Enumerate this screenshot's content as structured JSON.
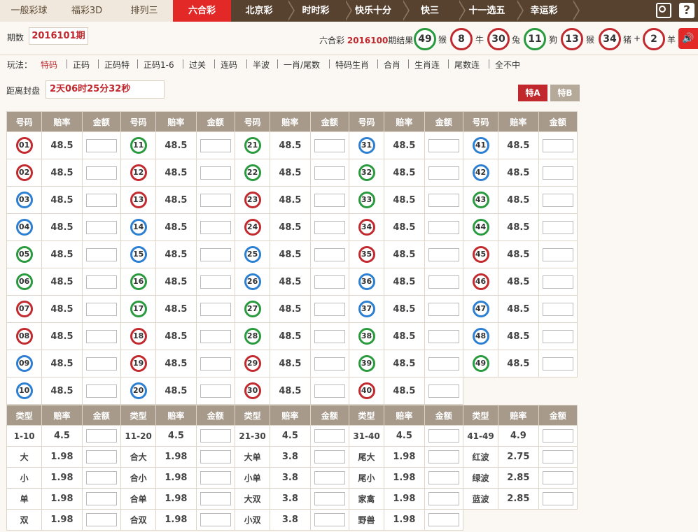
{
  "nav": {
    "tabs": [
      "一般彩球",
      "福彩3D",
      "排列三",
      "六合彩",
      "北京彩",
      "时时彩",
      "快乐十分",
      "快三",
      "十一选五",
      "幸运彩"
    ],
    "active": "六合彩"
  },
  "period": {
    "label": "期数",
    "value": "2016101期",
    "result_prefix": "六合彩",
    "result_period": "2016100",
    "result_suffix": "期结果",
    "plus": "+",
    "result_balls": [
      {
        "num": "49",
        "zodiac": "猴",
        "color": "green"
      },
      {
        "num": "8",
        "zodiac": "牛",
        "color": "red"
      },
      {
        "num": "30",
        "zodiac": "兔",
        "color": "red"
      },
      {
        "num": "11",
        "zodiac": "狗",
        "color": "green"
      },
      {
        "num": "13",
        "zodiac": "猴",
        "color": "red"
      },
      {
        "num": "34",
        "zodiac": "猪",
        "color": "red"
      },
      {
        "num": "2",
        "zodiac": "羊",
        "color": "red"
      }
    ]
  },
  "play": {
    "label": "玩法：",
    "items": [
      "特码",
      "正码",
      "正码特",
      "正码1-6",
      "过关",
      "连码",
      "半波",
      "一肖/尾数",
      "特码生肖",
      "合肖",
      "生肖连",
      "尾数连",
      "全不中"
    ],
    "selected": "特码"
  },
  "countdown": {
    "label": "距离封盘",
    "value": "2天06时25分32秒"
  },
  "buttons": {
    "a": "特A",
    "b": "特B"
  },
  "num_table": {
    "headers": [
      "号码",
      "赔率",
      "金额"
    ],
    "odds": "48.5",
    "balls": [
      {
        "n": "01",
        "c": "red"
      },
      {
        "n": "02",
        "c": "red"
      },
      {
        "n": "03",
        "c": "blue"
      },
      {
        "n": "04",
        "c": "blue"
      },
      {
        "n": "05",
        "c": "green"
      },
      {
        "n": "06",
        "c": "green"
      },
      {
        "n": "07",
        "c": "red"
      },
      {
        "n": "08",
        "c": "red"
      },
      {
        "n": "09",
        "c": "blue"
      },
      {
        "n": "10",
        "c": "blue"
      },
      {
        "n": "11",
        "c": "green"
      },
      {
        "n": "12",
        "c": "red"
      },
      {
        "n": "13",
        "c": "red"
      },
      {
        "n": "14",
        "c": "blue"
      },
      {
        "n": "15",
        "c": "blue"
      },
      {
        "n": "16",
        "c": "green"
      },
      {
        "n": "17",
        "c": "green"
      },
      {
        "n": "18",
        "c": "red"
      },
      {
        "n": "19",
        "c": "red"
      },
      {
        "n": "20",
        "c": "blue"
      },
      {
        "n": "21",
        "c": "green"
      },
      {
        "n": "22",
        "c": "green"
      },
      {
        "n": "23",
        "c": "red"
      },
      {
        "n": "24",
        "c": "red"
      },
      {
        "n": "25",
        "c": "blue"
      },
      {
        "n": "26",
        "c": "blue"
      },
      {
        "n": "27",
        "c": "green"
      },
      {
        "n": "28",
        "c": "green"
      },
      {
        "n": "29",
        "c": "red"
      },
      {
        "n": "30",
        "c": "red"
      },
      {
        "n": "31",
        "c": "blue"
      },
      {
        "n": "32",
        "c": "green"
      },
      {
        "n": "33",
        "c": "green"
      },
      {
        "n": "34",
        "c": "red"
      },
      {
        "n": "35",
        "c": "red"
      },
      {
        "n": "36",
        "c": "blue"
      },
      {
        "n": "37",
        "c": "blue"
      },
      {
        "n": "38",
        "c": "green"
      },
      {
        "n": "39",
        "c": "green"
      },
      {
        "n": "40",
        "c": "red"
      },
      {
        "n": "41",
        "c": "blue"
      },
      {
        "n": "42",
        "c": "blue"
      },
      {
        "n": "43",
        "c": "green"
      },
      {
        "n": "44",
        "c": "green"
      },
      {
        "n": "45",
        "c": "red"
      },
      {
        "n": "46",
        "c": "red"
      },
      {
        "n": "47",
        "c": "blue"
      },
      {
        "n": "48",
        "c": "blue"
      },
      {
        "n": "49",
        "c": "green"
      }
    ]
  },
  "type_table": {
    "headers": [
      "类型",
      "赔率",
      "金额"
    ],
    "columns": [
      [
        {
          "t": "1-10",
          "o": "4.5"
        },
        {
          "t": "大",
          "o": "1.98"
        },
        {
          "t": "小",
          "o": "1.98"
        },
        {
          "t": "单",
          "o": "1.98"
        },
        {
          "t": "双",
          "o": "1.98"
        }
      ],
      [
        {
          "t": "11-20",
          "o": "4.5"
        },
        {
          "t": "合大",
          "o": "1.98"
        },
        {
          "t": "合小",
          "o": "1.98"
        },
        {
          "t": "合单",
          "o": "1.98"
        },
        {
          "t": "合双",
          "o": "1.98"
        }
      ],
      [
        {
          "t": "21-30",
          "o": "4.5"
        },
        {
          "t": "大单",
          "o": "3.8"
        },
        {
          "t": "小单",
          "o": "3.8"
        },
        {
          "t": "大双",
          "o": "3.8"
        },
        {
          "t": "小双",
          "o": "3.8"
        }
      ],
      [
        {
          "t": "31-40",
          "o": "4.5"
        },
        {
          "t": "尾大",
          "o": "1.98"
        },
        {
          "t": "尾小",
          "o": "1.98"
        },
        {
          "t": "家禽",
          "o": "1.98"
        },
        {
          "t": "野兽",
          "o": "1.98"
        }
      ],
      [
        {
          "t": "41-49",
          "o": "4.9"
        },
        {
          "t": "红波",
          "o": "2.75"
        },
        {
          "t": "绿波",
          "o": "2.85"
        },
        {
          "t": "蓝波",
          "o": "2.85"
        }
      ]
    ]
  },
  "colors": {
    "red": "#c12a2e",
    "blue": "#2d7fd1",
    "green": "#2a9a3e",
    "nav_bg": "#57412f",
    "active_tab": "#e32928"
  }
}
